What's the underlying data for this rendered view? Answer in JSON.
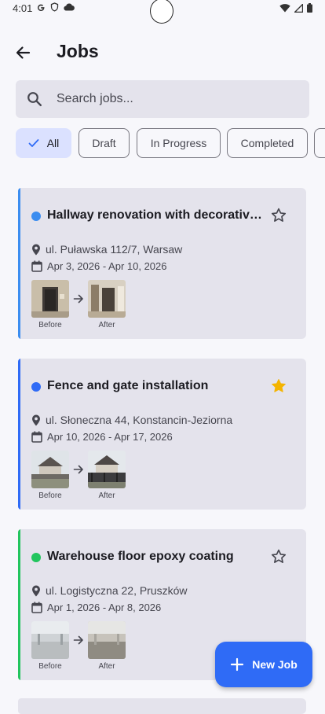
{
  "status_bar": {
    "time": "4:01",
    "left_icons": [
      "google-g-icon",
      "shield-icon",
      "cloud-icon"
    ],
    "right_icons": [
      "wifi-icon",
      "signal-icon",
      "battery-icon"
    ]
  },
  "app_bar": {
    "title": "Jobs",
    "back_icon": "arrow-back-icon"
  },
  "search": {
    "placeholder": "Search jobs...",
    "value": ""
  },
  "filters": [
    {
      "label": "All",
      "selected": true
    },
    {
      "label": "Draft",
      "selected": false
    },
    {
      "label": "In Progress",
      "selected": false
    },
    {
      "label": "Completed",
      "selected": false
    }
  ],
  "colors": {
    "accent_blue": "#2f6bf6",
    "status_sky": "#3b8df0",
    "status_green": "#22c55e",
    "star_gold": "#f4b400",
    "chip_selected": "#dbe1ff",
    "card_bg": "#e4e3ec"
  },
  "jobs": [
    {
      "title": "Hallway renovation with decorative wall panels",
      "location": "ul. Puławska 112/7, Warsaw",
      "dates": "Apr 3, 2026 - Apr 10, 2026",
      "favorite": false,
      "status_color": "#3b8df0",
      "before_label": "Before",
      "after_label": "After"
    },
    {
      "title": "Fence and gate installation",
      "location": "ul. Słoneczna 44, Konstancin-Jeziorna",
      "dates": "Apr 10, 2026 - Apr 17, 2026",
      "favorite": true,
      "status_color": "#2f6bf6",
      "before_label": "Before",
      "after_label": "After"
    },
    {
      "title": "Warehouse floor epoxy coating",
      "location": "ul. Logistyczna 22, Pruszków",
      "dates": "Apr 1, 2026 - Apr 8, 2026",
      "favorite": false,
      "status_color": "#22c55e",
      "before_label": "Before",
      "after_label": "After"
    }
  ],
  "fab": {
    "label": "New Job",
    "icon": "plus-icon"
  }
}
